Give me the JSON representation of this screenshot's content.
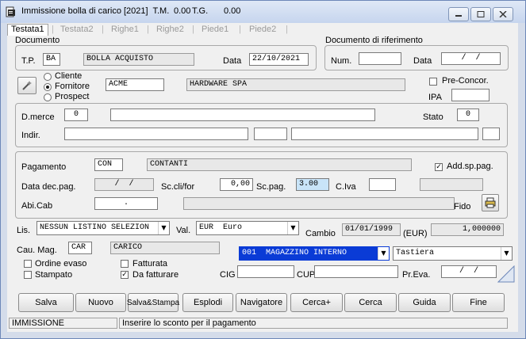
{
  "window": {
    "title": "Immissione bolla di carico [2021]  T.M.",
    "tm_value": "0.00",
    "tg_label": "T.G.",
    "tg_value": "0.00"
  },
  "tabs": [
    "Testata1",
    "Testata2",
    "Righe1",
    "Righe2",
    "Piede1",
    "Piede2"
  ],
  "documento": {
    "group_label": "Documento",
    "tp_label": "T.P.",
    "tp_value": "BA",
    "tp_desc": "BOLLA ACQUISTO",
    "data_label": "Data",
    "data_value": "22/10/2021"
  },
  "riferimento": {
    "group_label": "Documento di riferimento",
    "num_label": "Num.",
    "num_value": "",
    "data_label": "Data",
    "data_value": "/  /"
  },
  "soggetto": {
    "options": [
      "Cliente",
      "Fornitore",
      "Prospect"
    ],
    "selected": "Fornitore",
    "code": "ACME",
    "name": "HARDWARE SPA",
    "preconcor_label": "Pre-Concor.",
    "ipa_label": "IPA",
    "ipa_value": ""
  },
  "destinazione": {
    "dmerce_label": "D.merce",
    "dmerce_code": "0",
    "stato_label": "Stato",
    "stato_value": "0",
    "indir_label": "Indir."
  },
  "pagamento": {
    "label": "Pagamento",
    "code": "CON",
    "desc": "CONTANTI",
    "addsp_label": "Add.sp.pag.",
    "addsp_checked": true,
    "datadec_label": "Data dec.pag.",
    "datadec_value": "/  /",
    "sccli_label": "Sc.cli/for",
    "sccli_value": "0,00",
    "scpag_label": "Sc.pag.",
    "scpag_value": "3.00",
    "civa_label": "C.Iva",
    "abicab_label": "Abi.Cab",
    "abicab_value": ".",
    "fido_label": "Fido"
  },
  "listino": {
    "lis_label": "Lis.",
    "lis_value": "NESSUN LISTINO SELEZION",
    "val_label": "Val.",
    "val_value": "EUR  Euro",
    "cambio_label": "Cambio",
    "cambio_date": "01/01/1999",
    "eur_label": "(EUR)",
    "cambio_value": "1,000000"
  },
  "magazzino": {
    "causale_label": "Cau. Mag.",
    "causale_code": "CAR",
    "causale_desc": "CARICO",
    "magazzino_value": "001  MAGAZZINO INTERNO",
    "input_value": "Tastiera",
    "ordine_evaso": "Ordine evaso",
    "stampato": "Stampato",
    "fatturata": "Fatturata",
    "da_fatturare": "Da fatturare",
    "cig_label": "CIG",
    "cup_label": "CUP",
    "preva_label": "Pr.Eva.",
    "preva_value": "/  /"
  },
  "buttons": [
    "Salva",
    "Nuovo",
    "Salva&Stampa",
    "Esplodi",
    "Navigatore",
    "Cerca+",
    "Cerca",
    "Guida",
    "Fine"
  ],
  "status": {
    "left": "IMMISSIONE",
    "right": "Inserire lo sconto per il pagamento"
  }
}
